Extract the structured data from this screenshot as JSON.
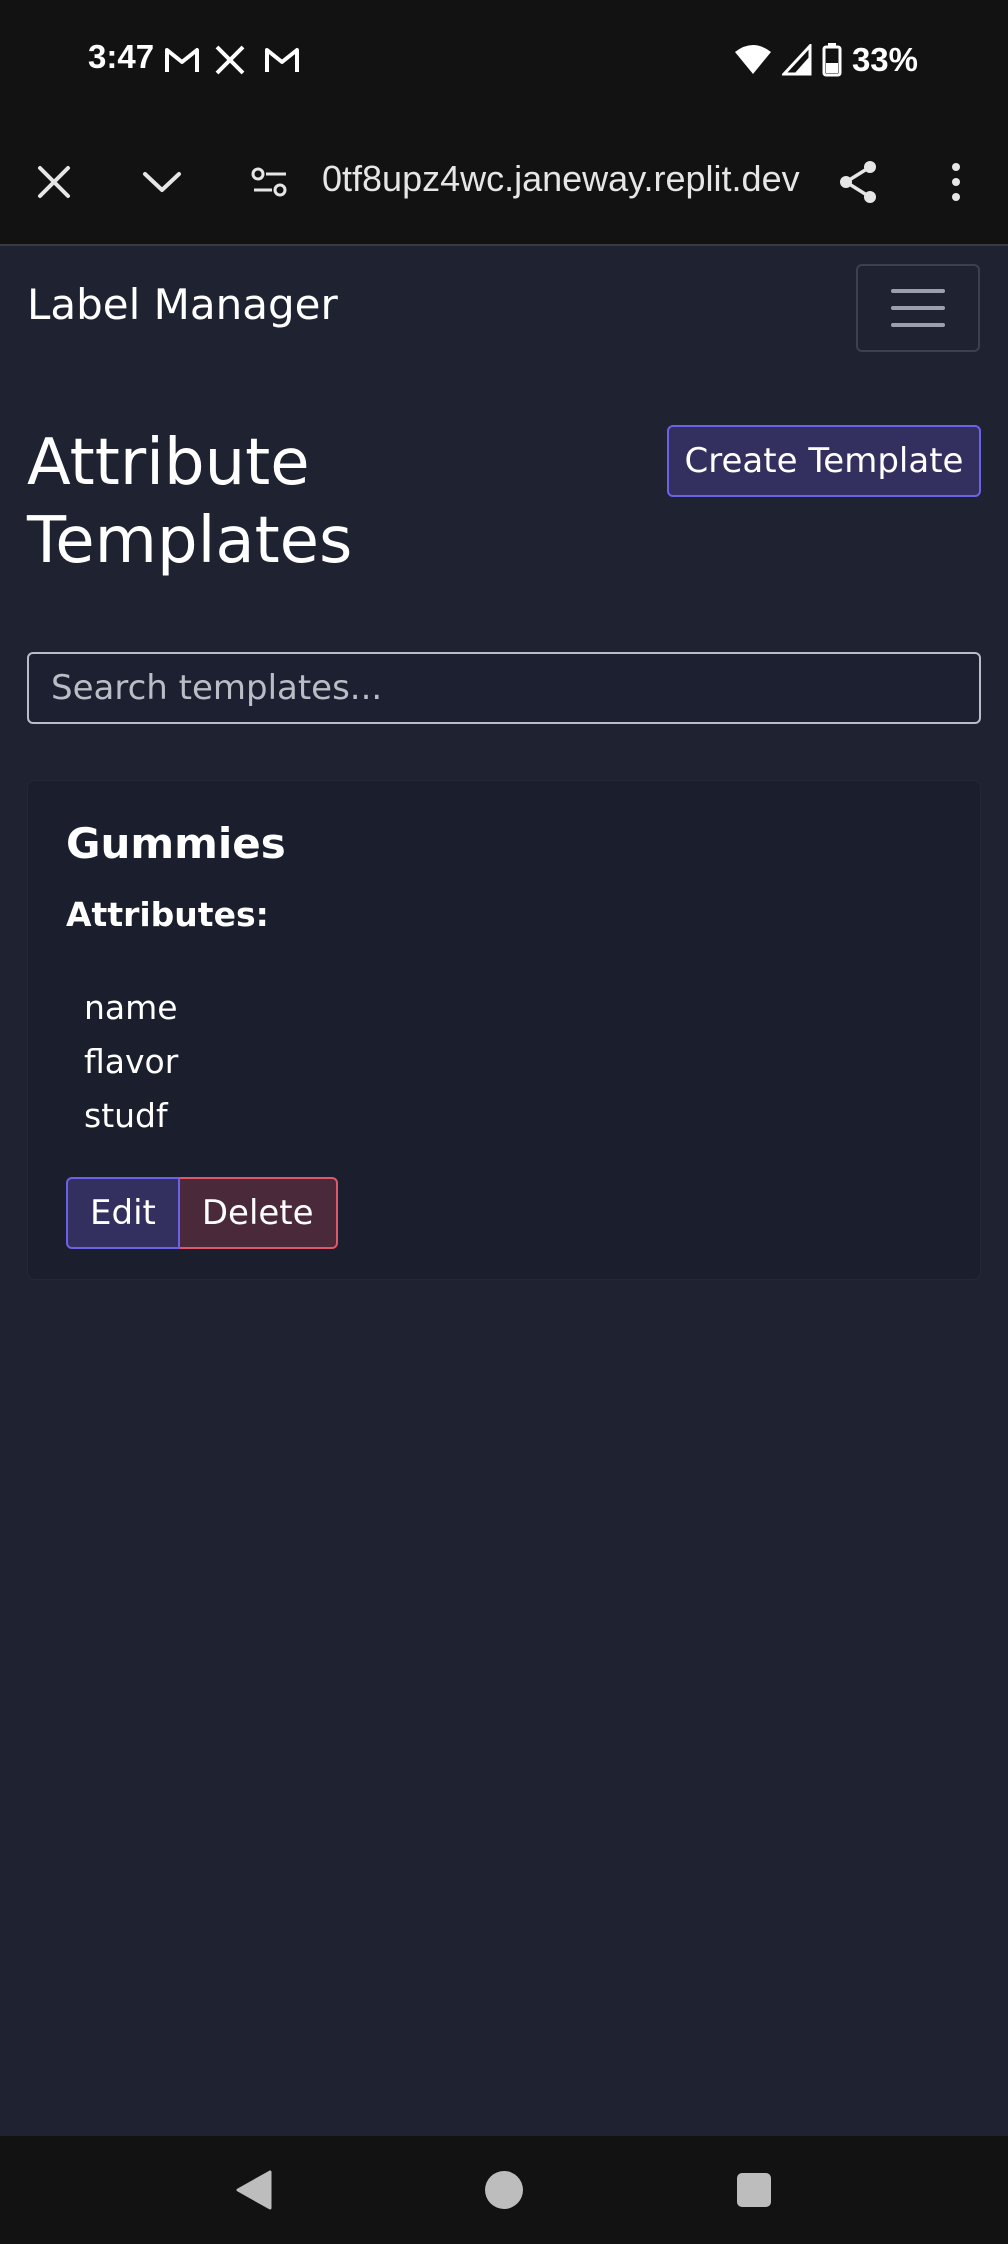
{
  "status_bar": {
    "time": "3:47",
    "notifications": [
      "gmail-icon",
      "x-icon",
      "gmail-icon"
    ],
    "battery": "33%"
  },
  "browser": {
    "url": "0tf8upz4wc.janeway.replit.dev"
  },
  "navbar": {
    "brand": "Label Manager"
  },
  "page": {
    "title": "Attribute Templates",
    "create_button": "Create Template"
  },
  "search": {
    "placeholder": "Search templates..."
  },
  "templates": [
    {
      "name": "Gummies",
      "attributes_heading": "Attributes:",
      "attributes": [
        "name",
        "flavor",
        "studf"
      ],
      "edit_label": "Edit",
      "delete_label": "Delete"
    }
  ],
  "colors": {
    "background": "#1e2231",
    "primary": "#6b63e6",
    "danger": "#e0566a"
  }
}
